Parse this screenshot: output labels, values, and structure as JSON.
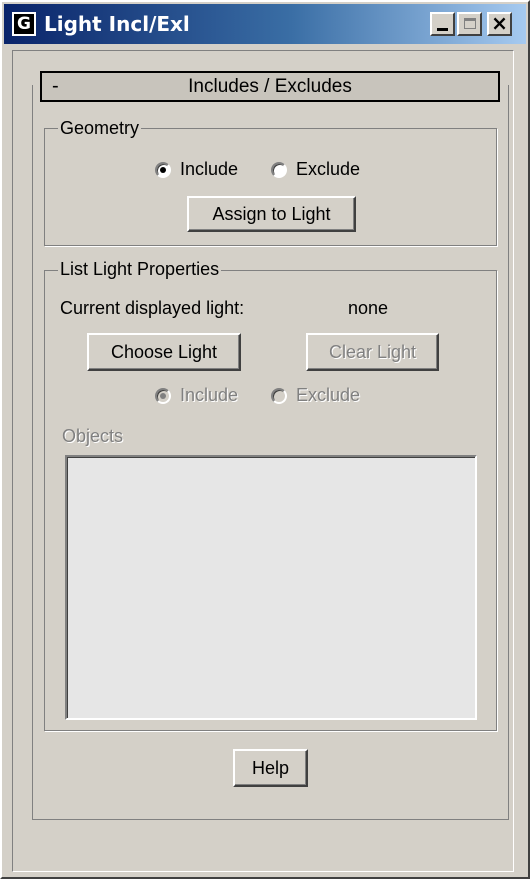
{
  "window": {
    "title": "Light Incl/Exl",
    "app_icon_glyph": "G",
    "close_glyph": "×"
  },
  "rollout": {
    "toggle": "-",
    "title": "Includes / Excludes"
  },
  "geometry": {
    "group_label": "Geometry",
    "include_label": "Include",
    "exclude_label": "Exclude",
    "selected": "include",
    "assign_button": "Assign to Light"
  },
  "list_light": {
    "group_label": "List Light Properties",
    "current_label": "Current displayed light:",
    "current_value": "none",
    "choose_button": "Choose Light",
    "clear_button": "Clear Light",
    "include_label": "Include",
    "exclude_label": "Exclude",
    "selected": "include",
    "objects_label": "Objects",
    "objects": []
  },
  "footer": {
    "help_button": "Help"
  }
}
